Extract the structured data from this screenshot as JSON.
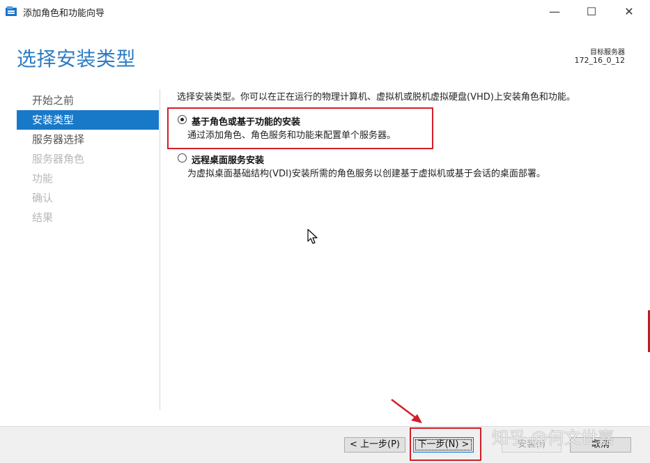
{
  "window": {
    "title": "添加角色和功能向导",
    "controls": {
      "minimize": "—",
      "maximize": "☐",
      "close": "✕"
    }
  },
  "page": {
    "heading": "选择安装类型",
    "destination_label": "目标服务器",
    "destination_value": "172_16_0_12"
  },
  "nav": {
    "items": [
      {
        "label": "开始之前",
        "state": "normal"
      },
      {
        "label": "安装类型",
        "state": "active"
      },
      {
        "label": "服务器选择",
        "state": "normal"
      },
      {
        "label": "服务器角色",
        "state": "disabled"
      },
      {
        "label": "功能",
        "state": "disabled"
      },
      {
        "label": "确认",
        "state": "disabled"
      },
      {
        "label": "结果",
        "state": "disabled"
      }
    ]
  },
  "content": {
    "intro": "选择安装类型。你可以在正在运行的物理计算机、虚拟机或脱机虚拟硬盘(VHD)上安装角色和功能。",
    "options": [
      {
        "title": "基于角色或基于功能的安装",
        "description": "通过添加角色、角色服务和功能来配置单个服务器。",
        "selected": true
      },
      {
        "title": "远程桌面服务安装",
        "description": "为虚拟桌面基础结构(VDI)安装所需的角色服务以创建基于虚拟机或基于会话的桌面部署。",
        "selected": false
      }
    ]
  },
  "footer": {
    "back_label": "< 上一步(P)",
    "next_label": "下一步(N) >",
    "install_label": "安装(I)",
    "cancel_label": "取消"
  },
  "watermark": "知乎 @何文世嘉",
  "colors": {
    "accent": "#2b7cc4",
    "nav_active": "#1879c9",
    "annotation_red": "#d11f2a"
  }
}
